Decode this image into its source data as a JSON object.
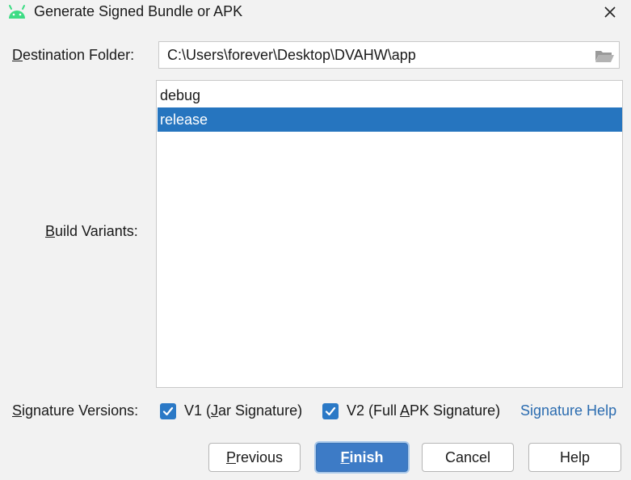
{
  "titlebar": {
    "title": "Generate Signed Bundle or APK",
    "app_icon": "android-icon",
    "close_icon": "close-icon"
  },
  "destination": {
    "label_mnemonic": "D",
    "label_rest": "estination Folder:",
    "value": "C:\\Users\\forever\\Desktop\\DVAHW\\app",
    "browse_icon": "folder-icon"
  },
  "build_variants": {
    "label_mnemonic": "B",
    "label_rest": "uild Variants:",
    "items": [
      {
        "label": "debug",
        "selected": false
      },
      {
        "label": "release",
        "selected": true
      }
    ]
  },
  "signature": {
    "label_mnemonic": "S",
    "label_rest": "ignature Versions:",
    "v1": {
      "pre": "V1 (",
      "mnemonic": "J",
      "post": "ar Signature)",
      "checked": true
    },
    "v2": {
      "pre": "V2 (Full ",
      "mnemonic": "A",
      "post": "PK Signature)",
      "checked": true
    },
    "help_link": "Signature Help"
  },
  "buttons": {
    "previous": {
      "mnemonic": "P",
      "rest": "revious"
    },
    "finish": {
      "mnemonic": "F",
      "rest": "inish"
    },
    "cancel": "Cancel",
    "help": "Help"
  },
  "colors": {
    "selection": "#2675bf",
    "checkbox": "#2b79c6",
    "link": "#2b6cb0",
    "android_green": "#3ddc84",
    "primary_button": "#3d7bc6"
  }
}
